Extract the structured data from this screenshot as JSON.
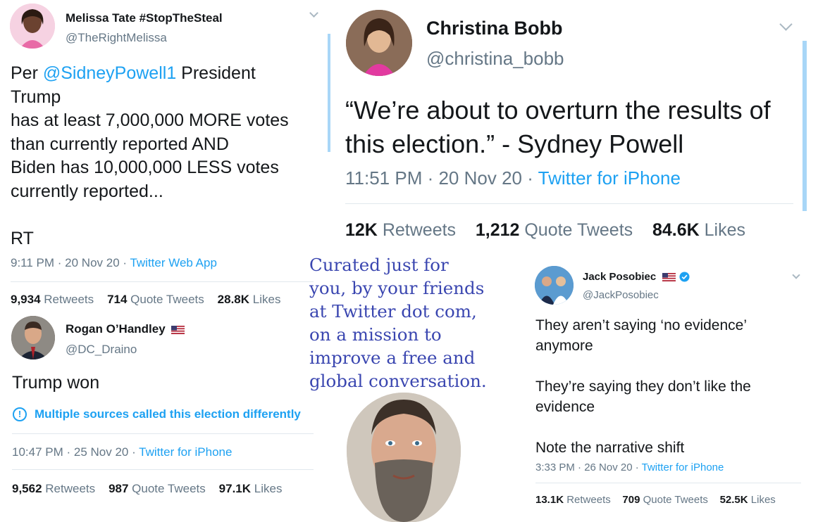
{
  "tweets": {
    "melissa": {
      "name": "Melissa Tate #StopTheSteal",
      "handle": "@TheRightMelissa",
      "body_prefix": "Per ",
      "mention": "@SidneyPowell1",
      "body_rest": " President\nTrump\n has at least 7,000,000 MORE votes\nthan currently reported AND\nBiden has 10,000,000 LESS votes\ncurrently reported...\n\nRT",
      "time": "9:11 PM · 20 Nov 20 · ",
      "source": "Twitter Web App",
      "retweets": "9,934",
      "retweets_label": "Retweets",
      "quotes": "714",
      "quotes_label": "Quote Tweets",
      "likes": "28.8K",
      "likes_label": "Likes"
    },
    "christina": {
      "name": "Christina Bobb",
      "handle": "@christina_bobb",
      "body": "“We’re about to overturn the results of this election.” - Sydney Powell",
      "time": "11:51 PM · 20 Nov 20 · ",
      "source": "Twitter for iPhone",
      "retweets": "12K",
      "retweets_label": "Retweets",
      "quotes": "1,212",
      "quotes_label": "Quote Tweets",
      "likes": "84.6K",
      "likes_label": "Likes"
    },
    "rogan": {
      "name": "Rogan O’Handley",
      "handle": "@DC_Draino",
      "body": "Trump won",
      "notice": "Multiple sources called this election differently",
      "time": "10:47 PM · 25 Nov 20 · ",
      "source": "Twitter for iPhone",
      "retweets": "9,562",
      "retweets_label": "Retweets",
      "quotes": "987",
      "quotes_label": "Quote Tweets",
      "likes": "97.1K",
      "likes_label": "Likes"
    },
    "jack": {
      "name": "Jack Posobiec",
      "handle": "@JackPosobiec",
      "body": "They aren’t saying ‘no evidence’\nanymore\n\nThey’re saying they don’t like the\nevidence\n\nNote the narrative shift",
      "time": "3:33 PM · 26 Nov 20 · ",
      "source": "Twitter for iPhone",
      "retweets": "13.1K",
      "retweets_label": "Retweets",
      "quotes": "709",
      "quotes_label": "Quote Tweets",
      "likes": "52.5K",
      "likes_label": "Likes"
    }
  },
  "caption": "Curated just for\nyou, by your friends\nat Twitter dot com,\non a mission to\nimprove a free and\nglobal conversation.",
  "colors": {
    "link": "#1da1f2",
    "caption": "#3a46b0",
    "muted": "#657786"
  }
}
